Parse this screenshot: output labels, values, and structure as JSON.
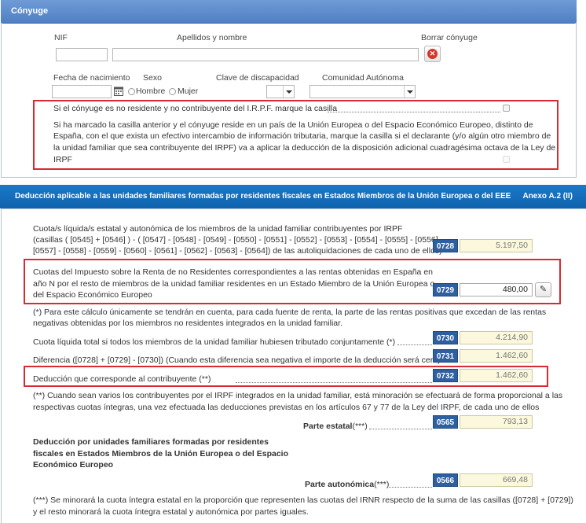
{
  "spouse": {
    "header": "Cónyuge",
    "nif_label": "NIF",
    "name_label": "Apellidos y nombre",
    "delete_label": "Borrar cónyuge",
    "birth_label": "Fecha de nacimiento",
    "sex_label": "Sexo",
    "male_label": "Hombre",
    "female_label": "Mujer",
    "disability_label": "Clave de discapacidad",
    "region_label": "Comunidad Autónoma",
    "nonresident_question": "Si el cónyuge es no residente y no contribuyente del I.R.P.F. marque la casilla",
    "eu_paragraph": [
      "Si ha marcado la casilla anterior y el cónyuge reside en un país de la Unión Europea o del Espacio Económico Europeo, distinto de",
      "España, con el que exista un efectivo intercambio de información tributaria, marque la casilla si el declarante (y/o algún otro miembro de",
      "la unidad familiar que sea contribuyente del IRPF) va a aplicar la deducción de la disposición adicional cuadragésima octava de la Ley de",
      "IRPF"
    ]
  },
  "deduction": {
    "title": "Deducción aplicable a las unidades familiares formadas por residentes fiscales en Estados Miembros de la Unión Europea o del EEE",
    "annex": "Anexo A.2 (II)",
    "row_0728": {
      "text": [
        "Cuota/s líquida/s estatal y autonómica de los miembros de la unidad familiar contribuyentes por IRPF",
        "(casillas ( [0545] + [0546] ) - ( [0547] - [0548] - [0549] - [0550] - [0551] - [0552] - [0553] - [0554] - [0555] - [0556] -",
        "[0557] - [0558] - [0559] - [0560] - [0561] - [0562] - [0563] - [0564]) de las autoliquidaciones de cada uno de ellos)"
      ],
      "code": "0728",
      "value": "5.197,50"
    },
    "row_0729": {
      "text": [
        "Cuotas del Impuesto sobre la Renta de no Residentes correspondientes a las rentas obtenidas en España en",
        "año N por el resto de miembros de la unidad familiar residentes en un Estado Miembro de la Unión Europea o",
        "del Espacio Económico Europeo"
      ],
      "code": "0729",
      "value": "480,00",
      "edit_icon": "pencil-icon"
    },
    "note_1": [
      "(*) Para este cálculo únicamente se tendrán en cuenta, para cada fuente de renta, la parte de las rentas positivas que excedan de las rentas",
      "negativas obtenidas por los miembros no residentes integrados en la unidad familiar."
    ],
    "row_0730": {
      "text": "Cuota líquida total si todos los miembros de la unidad familiar hubiesen tributado conjuntamente (*)",
      "code": "0730",
      "value": "4.214,90"
    },
    "row_0731": {
      "text": "Diferencia ([0728] + [0729] - [0730]) (Cuando esta diferencia sea negativa el importe de la deducción será cero)",
      "code": "0731",
      "value": "1.462,60"
    },
    "row_0732": {
      "text": "Deducción que corresponde al contribuyente (**)",
      "code": "0732",
      "value": "1.462,60"
    },
    "note_2": [
      "(**) Cuando sean varios los contribuyentes por el IRPF integrados en la unidad familiar, está minoración se efectuará de forma proporcional a las",
      "respectivas cuotas íntegras, una vez efectuada las deducciones previstas en los artículos 67 y 77 de la Ley del IRPF, de cada uno de ellos"
    ],
    "block_title": [
      "Deducción por unidades familiares formadas por residentes",
      "fiscales en Estados Miembros de la Unión Europea o del Espacio",
      "Económico Europeo"
    ],
    "row_0565": {
      "label": "Parte estatal",
      "suffix": "(***)",
      "code": "0565",
      "value": "793,13"
    },
    "row_0566": {
      "label": "Parte autonómica",
      "suffix": "(***)",
      "code": "0566",
      "value": "669,48"
    },
    "note_3": [
      "(***) Se minorará la cuota íntegra estatal en la proporción que representen las cuotas del IRNR respecto de la suma de las casillas ([0728] + [0729])",
      "y el resto minorará la cuota íntegra estatal y autonómica por partes iguales."
    ]
  },
  "colors": {
    "section_header": "#4f7fc4",
    "annex_header": "#1068b3",
    "code_box": "#2f5f9f",
    "highlight_border": "#d72a33",
    "amount_bg": "#fbf8de"
  }
}
